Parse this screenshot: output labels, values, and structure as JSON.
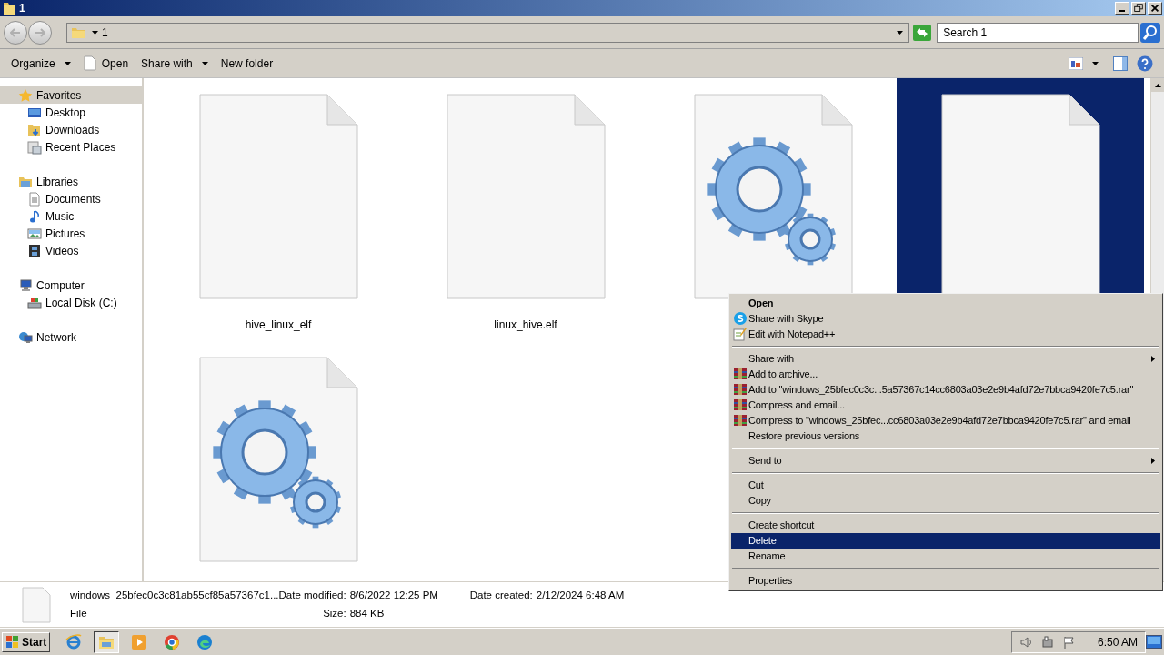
{
  "window": {
    "title": "1"
  },
  "address_bar": {
    "path": "1"
  },
  "search": {
    "placeholder": "Search 1"
  },
  "toolbar": [
    {
      "label": "Organize",
      "kind": "dropdown"
    },
    {
      "label": "Open",
      "kind": "document"
    },
    {
      "label": "Share with",
      "kind": "dropdown"
    },
    {
      "label": "New folder",
      "kind": "plain"
    }
  ],
  "sidebar": [
    {
      "label": "Favorites",
      "kind": "star",
      "selected": true,
      "children": [
        {
          "label": "Desktop",
          "kind": "desktop",
          "selected": false
        },
        {
          "label": "Downloads",
          "kind": "downloads",
          "selected": false
        },
        {
          "label": "Recent Places",
          "kind": "recent",
          "selected": false
        }
      ]
    },
    {
      "label": "Libraries",
      "kind": "library",
      "selected": false,
      "children": [
        {
          "label": "Documents",
          "kind": "documents",
          "selected": false
        },
        {
          "label": "Music",
          "kind": "music",
          "selected": false
        },
        {
          "label": "Pictures",
          "kind": "pictures",
          "selected": false
        },
        {
          "label": "Videos",
          "kind": "videos",
          "selected": false
        }
      ]
    },
    {
      "label": "Computer",
      "kind": "computer",
      "selected": false,
      "children": [
        {
          "label": "Local Disk (C:)",
          "kind": "disk",
          "selected": false
        }
      ]
    },
    {
      "label": "Network",
      "kind": "network",
      "selected": false
    }
  ],
  "files": [
    {
      "name": "hive_linux_elf",
      "kind": "blank",
      "selected": false
    },
    {
      "name": "linux_hive.elf",
      "kind": "blank",
      "selected": false
    },
    {
      "kind": "gears",
      "selected": false
    },
    {
      "kind": "blank",
      "selected": true
    },
    {
      "kind": "gears",
      "selected": false
    }
  ],
  "context_menu": [
    {
      "label": "Open",
      "kind": "default",
      "selected": false
    },
    {
      "label": "Share with Skype",
      "kind": "skype",
      "selected": false
    },
    {
      "label": "Edit with Notepad++",
      "kind": "notepad",
      "selected": false
    },
    {
      "kind": "separator"
    },
    {
      "label": "Share with",
      "kind": "submenu",
      "selected": false
    },
    {
      "label": "Add to archive...",
      "kind": "archive",
      "selected": false
    },
    {
      "label": "Add to \"windows_25bfec0c3c...5a57367c14cc6803a03e2e9b4afd72e7bbca9420fe7c5.rar\"",
      "kind": "archive",
      "selected": false
    },
    {
      "label": "Compress and email...",
      "kind": "archive",
      "selected": false
    },
    {
      "label": "Compress to \"windows_25bfec...cc6803a03e2e9b4afd72e7bbca9420fe7c5.rar\" and email",
      "kind": "archive",
      "selected": false
    },
    {
      "label": "Restore previous versions",
      "kind": "plain",
      "selected": false
    },
    {
      "kind": "separator"
    },
    {
      "label": "Send to",
      "kind": "submenu",
      "selected": false
    },
    {
      "kind": "separator"
    },
    {
      "label": "Cut",
      "kind": "plain",
      "selected": false
    },
    {
      "label": "Copy",
      "kind": "plain",
      "selected": false
    },
    {
      "kind": "separator"
    },
    {
      "label": "Create shortcut",
      "kind": "plain",
      "selected": false
    },
    {
      "label": "Delete",
      "kind": "plain",
      "selected": true
    },
    {
      "label": "Rename",
      "kind": "plain",
      "selected": false
    },
    {
      "kind": "separator"
    },
    {
      "label": "Properties",
      "kind": "plain",
      "selected": false
    }
  ],
  "details": {
    "name": "windows_25bfec0c3c81ab55cf85a57367c1...",
    "type": "File",
    "fields": [
      {
        "label": "Date modified:",
        "value": "8/6/2022 12:25 PM"
      },
      {
        "label": "Size:",
        "value": "884 KB"
      },
      {
        "label": "Date created:",
        "value": "2/12/2024 6:48 AM"
      }
    ]
  },
  "taskbar": {
    "start": "Start",
    "apps": [
      {
        "kind": "ie",
        "active": false
      },
      {
        "kind": "explorer",
        "active": true
      },
      {
        "kind": "media",
        "active": false
      },
      {
        "kind": "chrome",
        "active": false
      },
      {
        "kind": "edge",
        "active": false
      }
    ],
    "clock": "6:50 AM"
  }
}
